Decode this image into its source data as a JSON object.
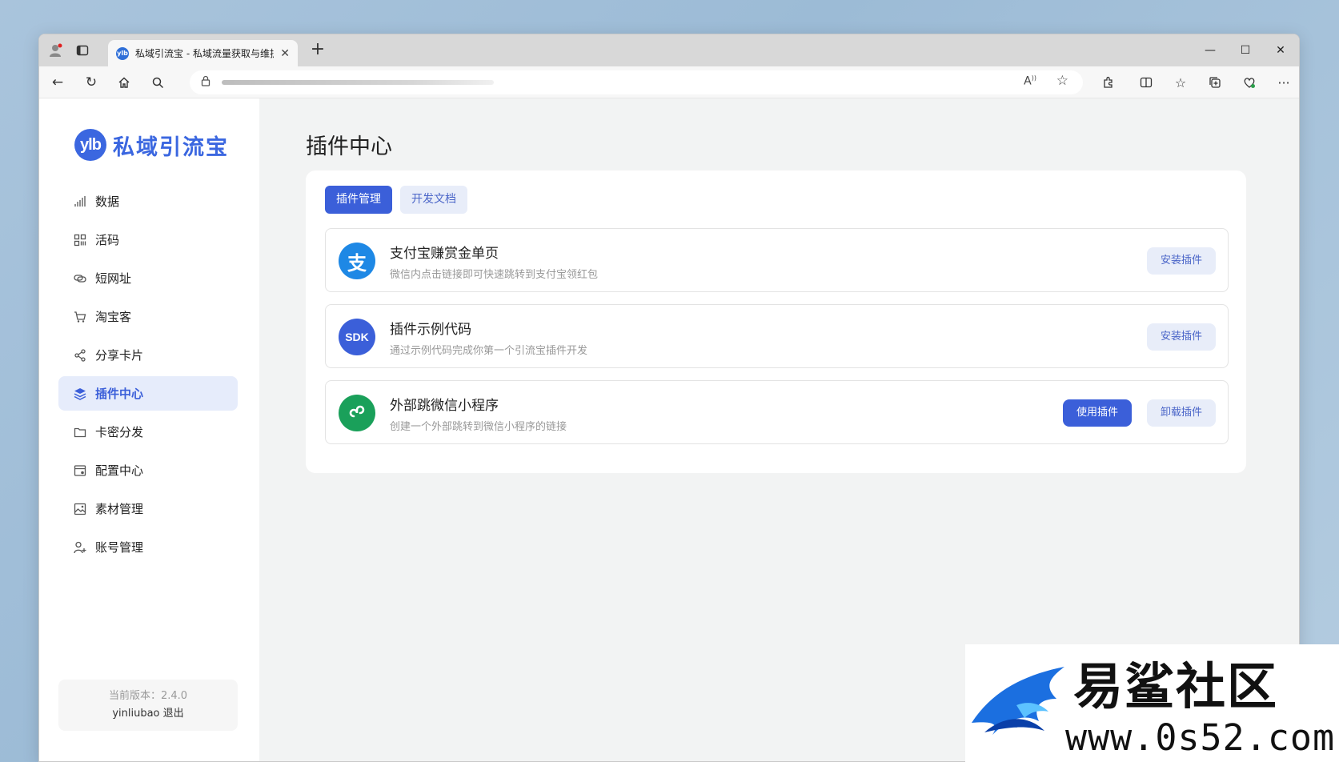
{
  "browser": {
    "tab_title": "私域引流宝 - 私域流量获取与维护",
    "tab_favicon": "ylb"
  },
  "sidebar": {
    "logo_mark": "ylb",
    "logo_name": "私域引流宝",
    "items": [
      {
        "label": "数据",
        "icon": "chart-icon"
      },
      {
        "label": "活码",
        "icon": "qr-grid-icon"
      },
      {
        "label": "短网址",
        "icon": "link-icon"
      },
      {
        "label": "淘宝客",
        "icon": "cart-icon"
      },
      {
        "label": "分享卡片",
        "icon": "share-icon"
      },
      {
        "label": "插件中心",
        "icon": "layers-icon",
        "active": true
      },
      {
        "label": "卡密分发",
        "icon": "folder-icon"
      },
      {
        "label": "配置中心",
        "icon": "settings-panel-icon"
      },
      {
        "label": "素材管理",
        "icon": "image-icon"
      },
      {
        "label": "账号管理",
        "icon": "user-add-icon"
      }
    ],
    "version_label": "当前版本：2.4.0",
    "username": "yinliubao",
    "logout_label": "退出"
  },
  "main": {
    "page_title": "插件中心",
    "tabs": [
      {
        "label": "插件管理",
        "active": true
      },
      {
        "label": "开发文档",
        "active": false
      }
    ],
    "plugins": [
      {
        "name": "支付宝赚赏金单页",
        "description": "微信内点击链接即可快速跳转到支付宝领红包",
        "icon": "alipay-icon",
        "icon_text": "支",
        "icon_color": "#1e88e5",
        "buttons": [
          "安装插件"
        ]
      },
      {
        "name": "插件示例代码",
        "description": "通过示例代码完成你第一个引流宝插件开发",
        "icon": "sdk-icon",
        "icon_text": "SDK",
        "icon_color": "#3b5fd9",
        "buttons": [
          "安装插件"
        ]
      },
      {
        "name": "外部跳微信小程序",
        "description": "创建一个外部跳转到微信小程序的链接",
        "icon": "miniprogram-icon",
        "icon_text": "",
        "icon_color": "#1aa05a",
        "buttons": [
          "使用插件",
          "卸载插件"
        ]
      }
    ]
  },
  "watermark": {
    "title": "易鲨社区",
    "url": "www.0s52.com"
  },
  "colors": {
    "accent": "#3b5fd9",
    "accent_light": "#e8edf9",
    "sidebar_active_bg": "#e6ecfb"
  }
}
